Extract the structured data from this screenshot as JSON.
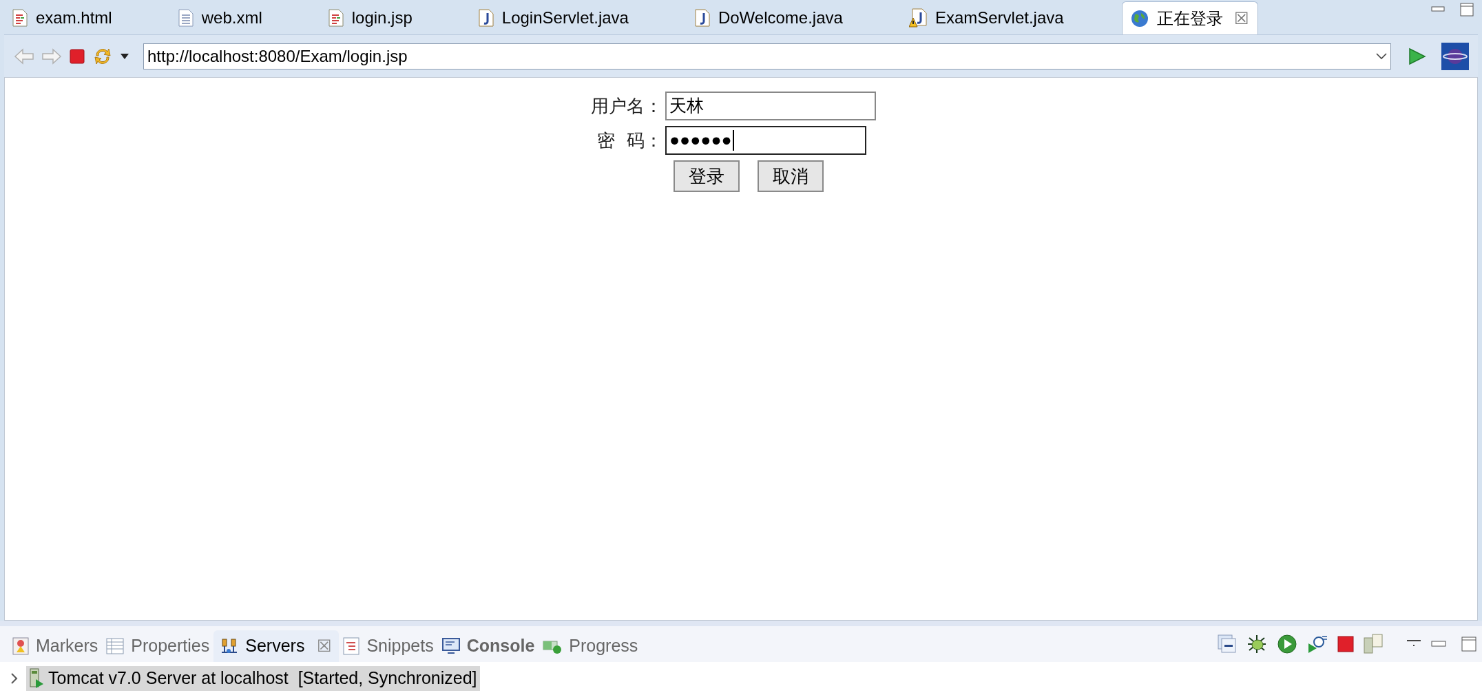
{
  "editor_tabs": [
    {
      "label": "exam.html",
      "kind": "html",
      "selected": false
    },
    {
      "label": "web.xml",
      "kind": "xml",
      "selected": false
    },
    {
      "label": "login.jsp",
      "kind": "html",
      "selected": false
    },
    {
      "label": "LoginServlet.java",
      "kind": "java",
      "selected": false
    },
    {
      "label": "DoWelcome.java",
      "kind": "java",
      "selected": false
    },
    {
      "label": "ExamServlet.java",
      "kind": "java-warning",
      "selected": false
    },
    {
      "label": "正在登录",
      "kind": "web",
      "selected": true,
      "close": "☒"
    }
  ],
  "browser": {
    "url": "http://localhost:8080/Exam/login.jsp"
  },
  "form": {
    "fields": [
      {
        "label": "用户名：",
        "value": "天林",
        "focused": false
      },
      {
        "label": "密  码：",
        "value": "●●●●●●",
        "focused": true
      }
    ],
    "buttons": [
      "登录",
      "取消"
    ]
  },
  "panel_tabs": [
    {
      "label": "Markers",
      "kind": "markers",
      "selected": false,
      "bold": false
    },
    {
      "label": "Properties",
      "kind": "properties",
      "selected": false,
      "bold": false
    },
    {
      "label": "Servers",
      "kind": "servers",
      "selected": true,
      "bold": false,
      "close": "☒"
    },
    {
      "label": "Snippets",
      "kind": "snippets",
      "selected": false,
      "bold": false
    },
    {
      "label": "Console",
      "kind": "console",
      "selected": false,
      "bold": true
    },
    {
      "label": "Progress",
      "kind": "progress",
      "selected": false,
      "bold": false
    }
  ],
  "servers": [
    {
      "name": "Tomcat v7.0 Server at localhost",
      "status": "[Started, Synchronized]",
      "expanded": false,
      "selected": true
    }
  ]
}
